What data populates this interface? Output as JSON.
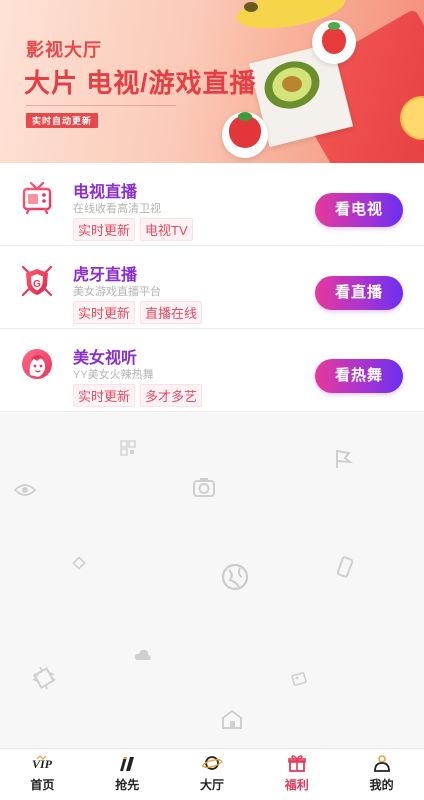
{
  "banner": {
    "subtitle": "影视大厅",
    "title": "大片 电视/游戏直播",
    "badge": "实时自动更新"
  },
  "channels": [
    {
      "name": "电视直播",
      "desc": "在线收看高清卫视",
      "tags": [
        "实时更新",
        "电视TV"
      ],
      "button": "看电视",
      "icon": "tv-icon"
    },
    {
      "name": "虎牙直播",
      "desc": "美女游戏直播平台",
      "tags": [
        "实时更新",
        "直播在线"
      ],
      "button": "看直播",
      "icon": "game-shield-icon"
    },
    {
      "name": "美女视听",
      "desc": "YY美女火辣热舞",
      "tags": [
        "实时更新",
        "多才多艺"
      ],
      "button": "看热舞",
      "icon": "woman-face-icon"
    }
  ],
  "tabbar": {
    "items": [
      {
        "label": "首页",
        "icon": "vip-icon",
        "active": false
      },
      {
        "label": "抢先",
        "icon": "film-icon",
        "active": false
      },
      {
        "label": "大厅",
        "icon": "planet-icon",
        "active": false
      },
      {
        "label": "福利",
        "icon": "gift-icon",
        "active": true
      },
      {
        "label": "我的",
        "icon": "user-icon",
        "active": false
      }
    ]
  },
  "colors": {
    "accent": "#e63a5a",
    "title_purple": "#8a2ed0",
    "button_gradient": [
      "#e6399b",
      "#6a2ff0"
    ]
  }
}
